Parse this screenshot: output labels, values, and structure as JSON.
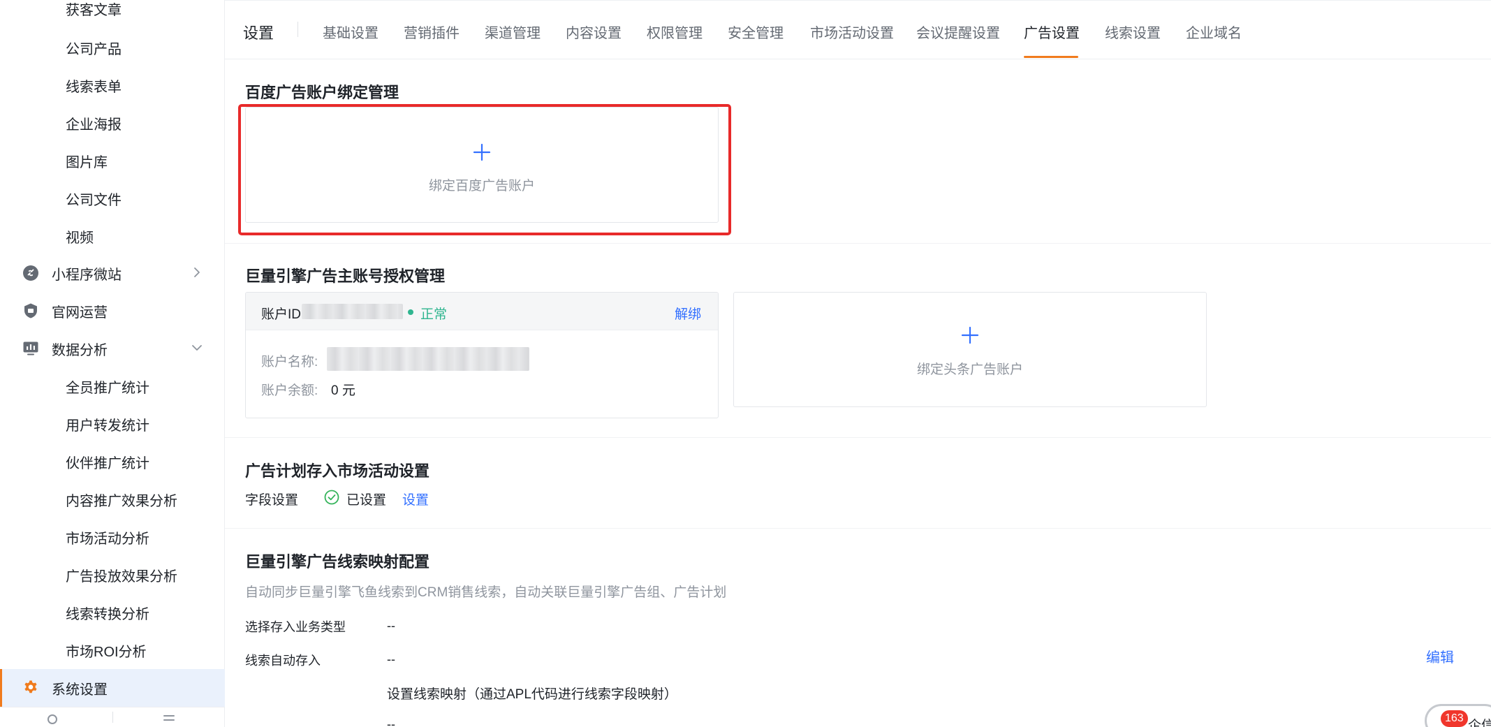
{
  "sidebar": {
    "sub_items_top": [
      {
        "label": "获客文章"
      },
      {
        "label": "公司产品"
      },
      {
        "label": "线索表单"
      },
      {
        "label": "企业海报"
      },
      {
        "label": "图片库"
      },
      {
        "label": "公司文件"
      },
      {
        "label": "视频"
      }
    ],
    "groups": {
      "mini_program": {
        "label": "小程序微站",
        "icon": "link-circle-icon"
      },
      "website": {
        "label": "官网运营",
        "icon": "shield-icon"
      },
      "analytics": {
        "label": "数据分析",
        "icon": "monitor-chart-icon"
      }
    },
    "analytics_items": [
      {
        "label": "全员推广统计"
      },
      {
        "label": "用户转发统计"
      },
      {
        "label": "伙伴推广统计"
      },
      {
        "label": "内容推广效果分析"
      },
      {
        "label": "市场活动分析"
      },
      {
        "label": "广告投放效果分析"
      },
      {
        "label": "线索转换分析"
      },
      {
        "label": "市场ROI分析"
      }
    ],
    "system": {
      "label": "系统设置",
      "icon": "gear-icon"
    }
  },
  "header": {
    "title": "设置",
    "tabs": [
      {
        "label": "基础设置"
      },
      {
        "label": "营销插件"
      },
      {
        "label": "渠道管理"
      },
      {
        "label": "内容设置"
      },
      {
        "label": "权限管理"
      },
      {
        "label": "安全管理"
      },
      {
        "label": "市场活动设置"
      },
      {
        "label": "会议提醒设置"
      },
      {
        "label": "广告设置"
      },
      {
        "label": "线索设置"
      },
      {
        "label": "企业域名"
      }
    ],
    "active_tab": "广告设置"
  },
  "baidu": {
    "title": "百度广告账户绑定管理",
    "add_label": "绑定百度广告账户"
  },
  "ocean": {
    "title": "巨量引擎广告主账号授权管理",
    "account_id_label": "账户ID",
    "status": "正常",
    "unbind_label": "解绑",
    "name_label": "账户名称:",
    "balance_label": "账户余额:",
    "balance_value": "0 元",
    "add_label": "绑定头条广告账户"
  },
  "plan": {
    "title": "广告计划存入市场活动设置",
    "field_label": "字段设置",
    "status": "已设置",
    "set_link": "设置"
  },
  "mapping": {
    "title": "巨量引擎广告线索映射配置",
    "description": "自动同步巨量引擎飞鱼线索到CRM销售线索，自动关联巨量引擎广告组、广告计划",
    "rows": [
      {
        "label": "选择存入业务类型",
        "value": "--"
      },
      {
        "label": "线索自动存入",
        "value": "--"
      }
    ],
    "mapping_text": "设置线索映射（通过APL代码进行线索字段映射）",
    "mapping_value": "--",
    "edit_label": "编辑"
  },
  "float": {
    "badge_count": "163",
    "label": "企信"
  },
  "colors": {
    "accent": "#f07b1d",
    "link": "#3370ff",
    "success": "#2fb58f",
    "highlight": "#e82a2a"
  }
}
